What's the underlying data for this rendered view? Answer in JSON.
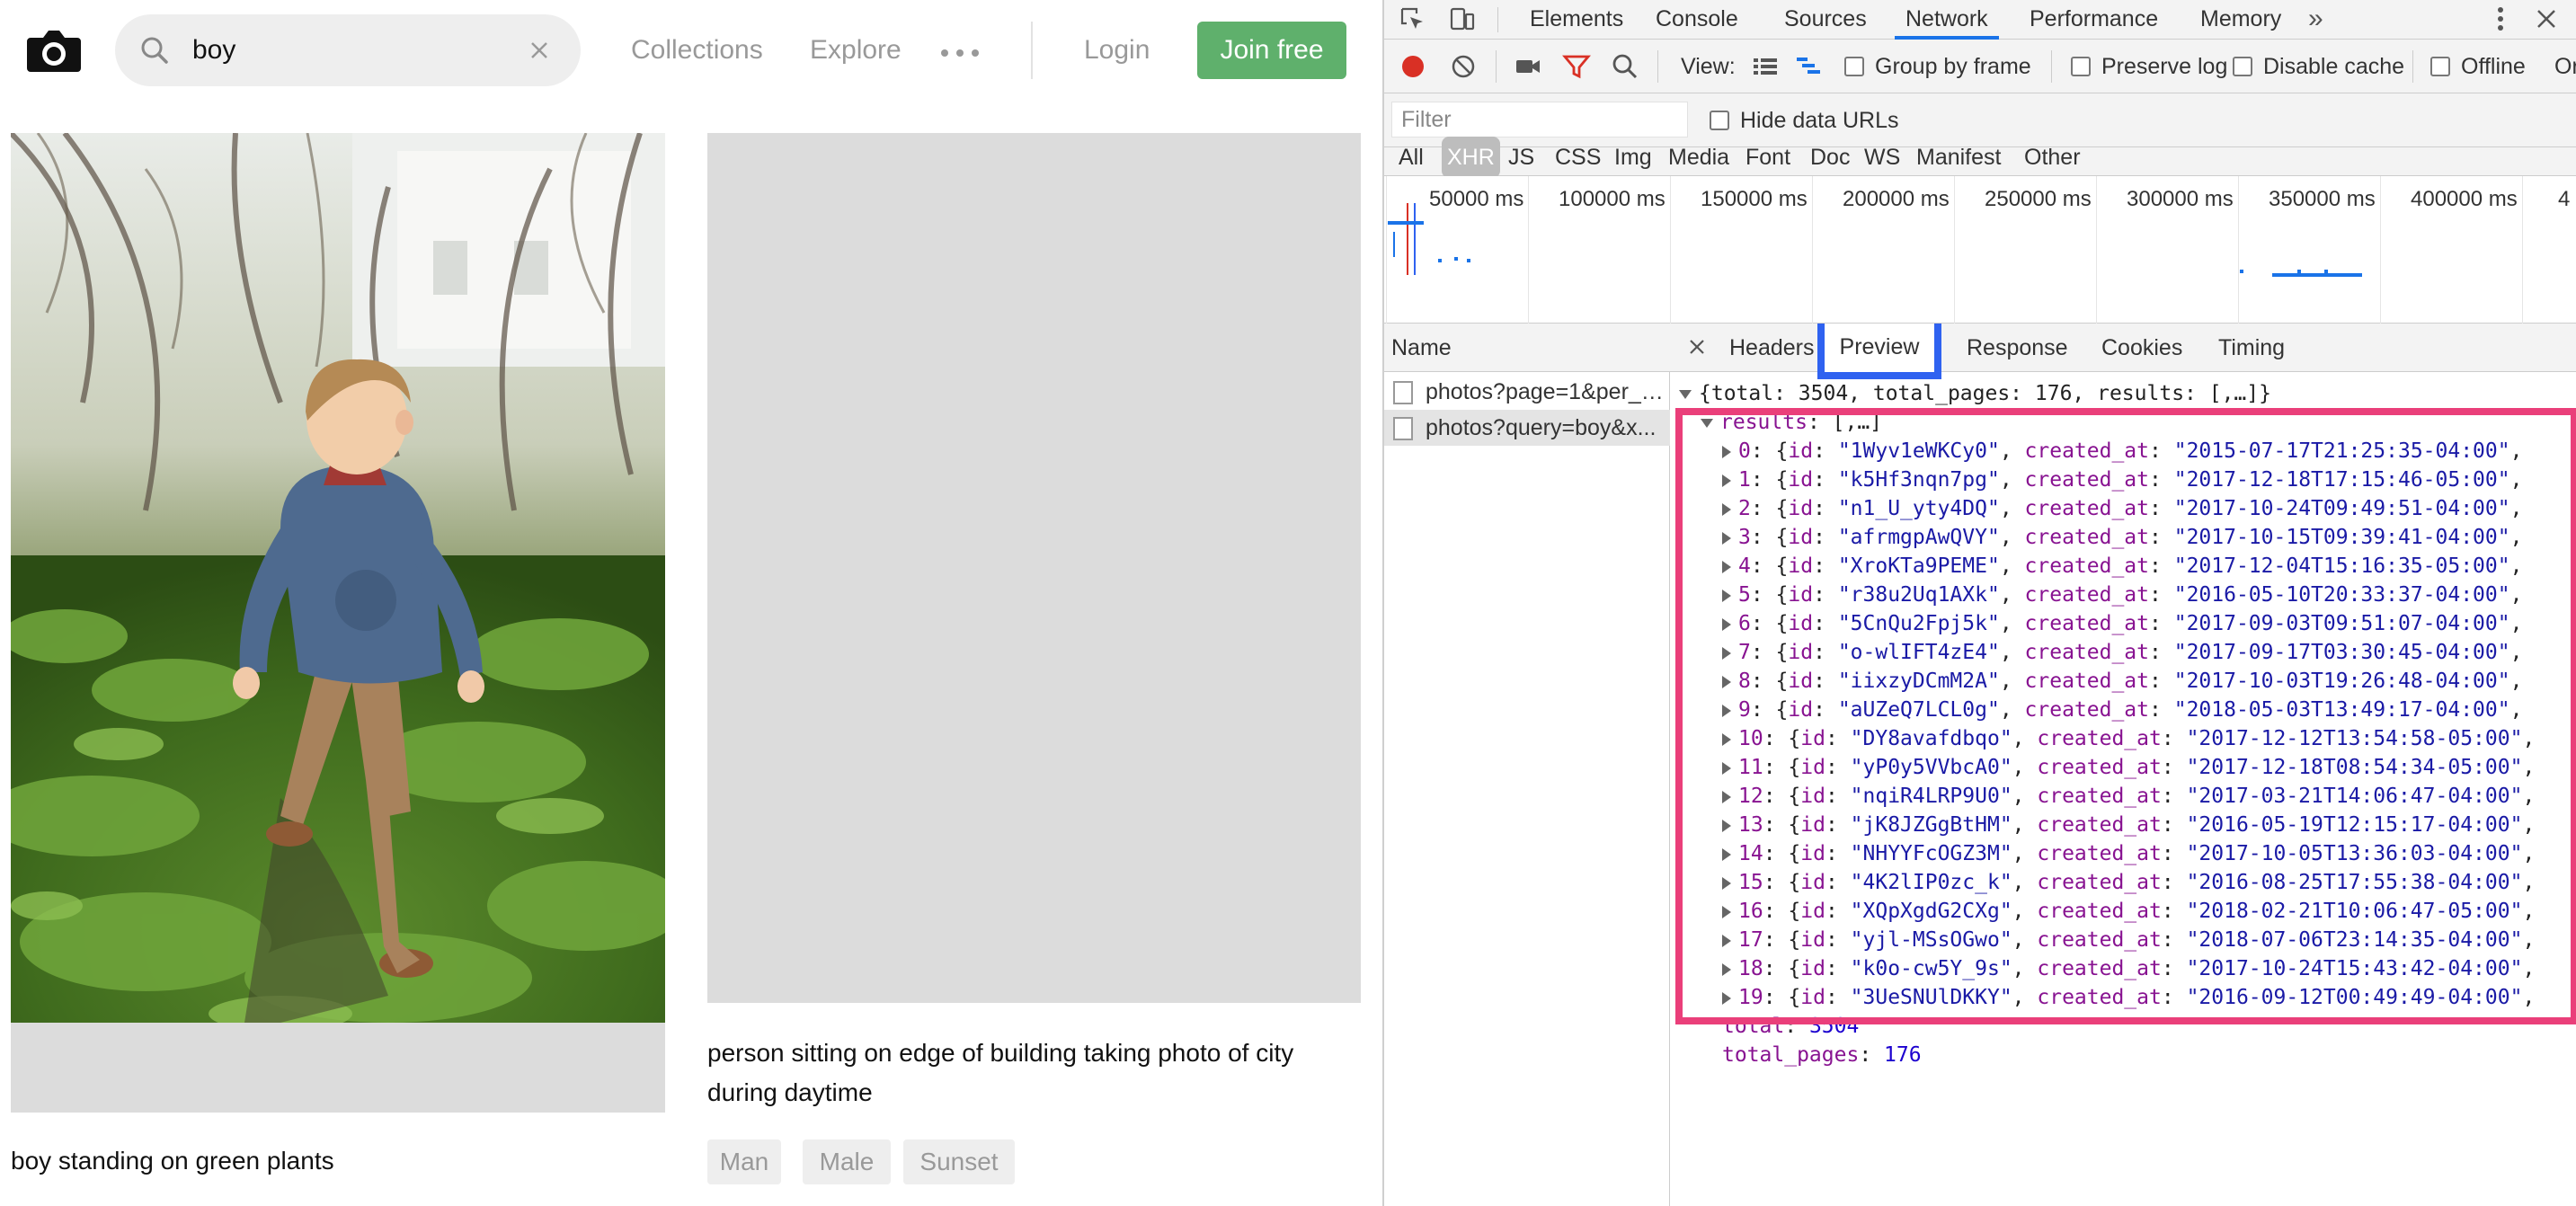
{
  "site": {
    "search": {
      "value": "boy"
    },
    "nav": {
      "collections": "Collections",
      "explore": "Explore"
    },
    "login": "Login",
    "join": "Join free",
    "cards": [
      {
        "caption": "boy standing on green plants"
      },
      {
        "caption": "person sitting on edge of building taking photo of city during daytime",
        "tags": [
          "Man",
          "Male",
          "Sunset"
        ]
      }
    ]
  },
  "devtools": {
    "tabs": [
      "Elements",
      "Console",
      "Sources",
      "Network",
      "Performance",
      "Memory"
    ],
    "active_tab": "Network",
    "more": "»",
    "toolbar": {
      "view_label": "View:",
      "group_by_frame": "Group by frame",
      "preserve_log": "Preserve log",
      "disable_cache": "Disable cache",
      "offline": "Offline",
      "online_truncated": "Or"
    },
    "filter": {
      "placeholder": "Filter",
      "hide_data_urls": "Hide data URLs"
    },
    "types": [
      "All",
      "XHR",
      "JS",
      "CSS",
      "Img",
      "Media",
      "Font",
      "Doc",
      "WS",
      "Manifest",
      "Other"
    ],
    "active_type": "XHR",
    "timeline_labels": [
      "50000 ms",
      "100000 ms",
      "150000 ms",
      "200000 ms",
      "250000 ms",
      "300000 ms",
      "350000 ms",
      "400000 ms",
      "4"
    ],
    "names_header": "Name",
    "requests": [
      "photos?page=1&per_page=...",
      "photos?query=boy&x..."
    ],
    "detail_tabs": [
      "Headers",
      "Preview",
      "Response",
      "Cookies",
      "Timing"
    ],
    "active_detail_tab": "Preview",
    "preview": {
      "summary": "{total: 3504, total_pages: 176, results: [,…]}",
      "results_key": "results",
      "results_summary": "[,…]",
      "results": [
        {
          "idx": "0",
          "id": "\"1Wyv1eWKCy0\"",
          "created_at": "\"2015-07-17T21:25:35-04:00\""
        },
        {
          "idx": "1",
          "id": "\"k5Hf3nqn7pg\"",
          "created_at": "\"2017-12-18T17:15:46-05:00\""
        },
        {
          "idx": "2",
          "id": "\"n1_U_yty4DQ\"",
          "created_at": "\"2017-10-24T09:49:51-04:00\""
        },
        {
          "idx": "3",
          "id": "\"afrmgpAwQVY\"",
          "created_at": "\"2017-10-15T09:39:41-04:00\""
        },
        {
          "idx": "4",
          "id": "\"XroKTa9PEME\"",
          "created_at": "\"2017-12-04T15:16:35-05:00\""
        },
        {
          "idx": "5",
          "id": "\"r38u2Uq1AXk\"",
          "created_at": "\"2016-05-10T20:33:37-04:00\""
        },
        {
          "idx": "6",
          "id": "\"5CnQu2Fpj5k\"",
          "created_at": "\"2017-09-03T09:51:07-04:00\""
        },
        {
          "idx": "7",
          "id": "\"o-wlIFT4zE4\"",
          "created_at": "\"2017-09-17T03:30:45-04:00\""
        },
        {
          "idx": "8",
          "id": "\"iixzyDCmM2A\"",
          "created_at": "\"2017-10-03T19:26:48-04:00\""
        },
        {
          "idx": "9",
          "id": "\"aUZeQ7LCL0g\"",
          "created_at": "\"2018-05-03T13:49:17-04:00\""
        },
        {
          "idx": "10",
          "id": "\"DY8avafdbqo\"",
          "created_at": "\"2017-12-12T13:54:58-05:00\""
        },
        {
          "idx": "11",
          "id": "\"yP0y5VVbcA0\"",
          "created_at": "\"2017-12-18T08:54:34-05:00\""
        },
        {
          "idx": "12",
          "id": "\"nqiR4LRP9U0\"",
          "created_at": "\"2017-03-21T14:06:47-04:00\""
        },
        {
          "idx": "13",
          "id": "\"jK8JZGgBtHM\"",
          "created_at": "\"2016-05-19T12:15:17-04:00\""
        },
        {
          "idx": "14",
          "id": "\"NHYYFcOGZ3M\"",
          "created_at": "\"2017-10-05T13:36:03-04:00\""
        },
        {
          "idx": "15",
          "id": "\"4K2lIP0zc_k\"",
          "created_at": "\"2016-08-25T17:55:38-04:00\""
        },
        {
          "idx": "16",
          "id": "\"XQpXgdG2CXg\"",
          "created_at": "\"2018-02-21T10:06:47-05:00\""
        },
        {
          "idx": "17",
          "id": "\"yjl-MSsOGwo\"",
          "created_at": "\"2018-07-06T23:14:35-04:00\""
        },
        {
          "idx": "18",
          "id": "\"k0o-cw5Y_9s\"",
          "created_at": "\"2017-10-24T15:43:42-04:00\""
        },
        {
          "idx": "19",
          "id": "\"3UeSNUlDKKY\"",
          "created_at": "\"2016-09-12T00:49:49-04:00\""
        }
      ],
      "total_key": "total",
      "total_value": "3504",
      "total_pages_key": "total_pages",
      "total_pages_value": "176"
    }
  },
  "colors": {
    "join_button": "#5fb06c",
    "preview_highlight": "#2f62f0",
    "results_highlight": "#ea3f7a",
    "network_tab_underline": "#1a73e8",
    "record_red": "#d93025"
  },
  "icons": {
    "logo": "camera-icon",
    "search": "search-icon",
    "clear": "close-icon",
    "more": "ellipsis-icon"
  }
}
